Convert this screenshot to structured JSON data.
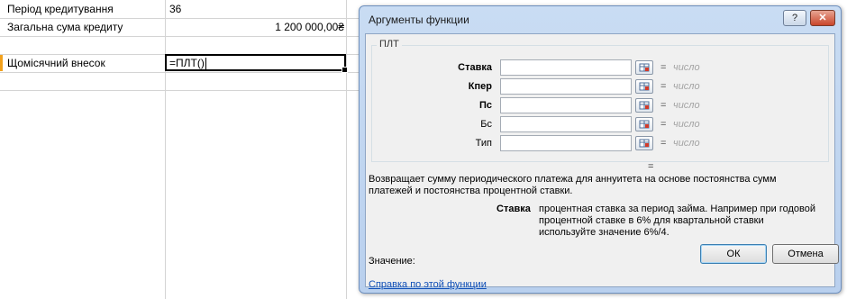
{
  "sheet": {
    "rows": [
      {
        "label": "Період кредитування",
        "value": "36"
      },
      {
        "label": "Загальна сума кредиту",
        "value": "1 200 000,00₴"
      },
      {
        "label": "",
        "value": ""
      },
      {
        "label": "Щомісячний внесок",
        "value": "=ПЛТ()"
      }
    ]
  },
  "dialog": {
    "title": "Аргументы функции",
    "help_icon": "?",
    "close_icon": "✕",
    "function_name": "ПЛТ",
    "args": [
      {
        "label": "Ставка",
        "hint": "число",
        "value": ""
      },
      {
        "label": "Кпер",
        "hint": "число",
        "value": ""
      },
      {
        "label": "Пс",
        "hint": "число",
        "value": ""
      },
      {
        "label": "Бс",
        "hint": "число",
        "value": ""
      },
      {
        "label": "Тип",
        "hint": "число",
        "value": ""
      }
    ],
    "equals": "=",
    "result_equals": "=",
    "description": "Возвращает сумму периодического платежа для аннуитета на основе постоянства сумм платежей и постоянства процентной ставки.",
    "arg_detail_label": "Ставка",
    "arg_detail_text": "процентная ставка за период займа. Например при годовой процентной ставке в 6% для квартальной ставки используйте значение 6%/4.",
    "value_label": "Значение:",
    "help_link": "Справка по этой функции",
    "ok_label": "ОК",
    "cancel_label": "Отмена"
  }
}
